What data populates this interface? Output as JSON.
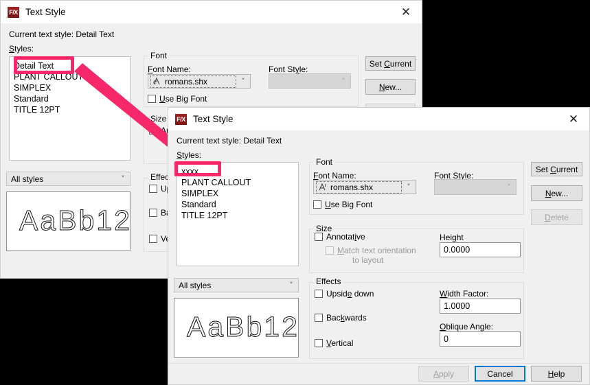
{
  "background_dialog": {
    "title": "Text Style",
    "icon": "fx-logo-icon",
    "close_label": "✕",
    "current_style_text": "Current text style: Detail Text",
    "styles_label": "Styles:",
    "styles_list": [
      "Detail Text",
      "PLANT CALLOUT",
      "SIMPLEX",
      "Standard",
      "TITLE 12PT"
    ],
    "filter_value": "All styles",
    "preview_text": "AaBb12",
    "font_group_title": "Font",
    "font_name_label": "Font Name:",
    "font_name_value": "romans.shx",
    "font_style_label": "Font Style:",
    "font_style_value": "",
    "use_big_font_label": "Use Big Font",
    "size_group_title": "Size",
    "annotative_label": "Ann",
    "effects_group_title": "Effects",
    "upside_down_label": "Up",
    "backwards_label": "Ba",
    "vertical_label": "Ve",
    "set_current_label": "Set Current",
    "new_label": "New..."
  },
  "front_dialog": {
    "title": "Text Style",
    "icon": "fx-logo-icon",
    "close_label": "✕",
    "current_style_text": "Current text style: Detail Text",
    "styles_label": "Styles:",
    "styles_list": [
      "xxxx",
      "PLANT CALLOUT",
      "SIMPLEX",
      "Standard",
      "TITLE 12PT"
    ],
    "filter_value": "All styles",
    "preview_text": "AaBb12",
    "font": {
      "group_title": "Font",
      "name_label": "Font Name:",
      "name_value": "romans.shx",
      "style_label": "Font Style:",
      "style_value": "",
      "use_big_font_label": "Use Big Font"
    },
    "size": {
      "group_title": "Size",
      "annotative_label": "Annotative",
      "match_label_line1": "Match text orientation",
      "match_label_line2": "to layout",
      "height_label": "Height",
      "height_value": "0.0000"
    },
    "effects": {
      "group_title": "Effects",
      "upside_down_label": "Upside down",
      "backwards_label": "Backwards",
      "vertical_label": "Vertical",
      "width_factor_label": "Width Factor:",
      "width_factor_value": "1.0000",
      "oblique_angle_label": "Oblique Angle:",
      "oblique_angle_value": "0"
    },
    "buttons": {
      "set_current": "Set Current",
      "new": "New...",
      "delete": "Delete",
      "apply": "Apply",
      "cancel": "Cancel",
      "help": "Help"
    }
  },
  "annotations": {
    "accent_color": "#f7286a",
    "highlight_back_target": "Detail Text",
    "highlight_front_target": "xxxx"
  }
}
